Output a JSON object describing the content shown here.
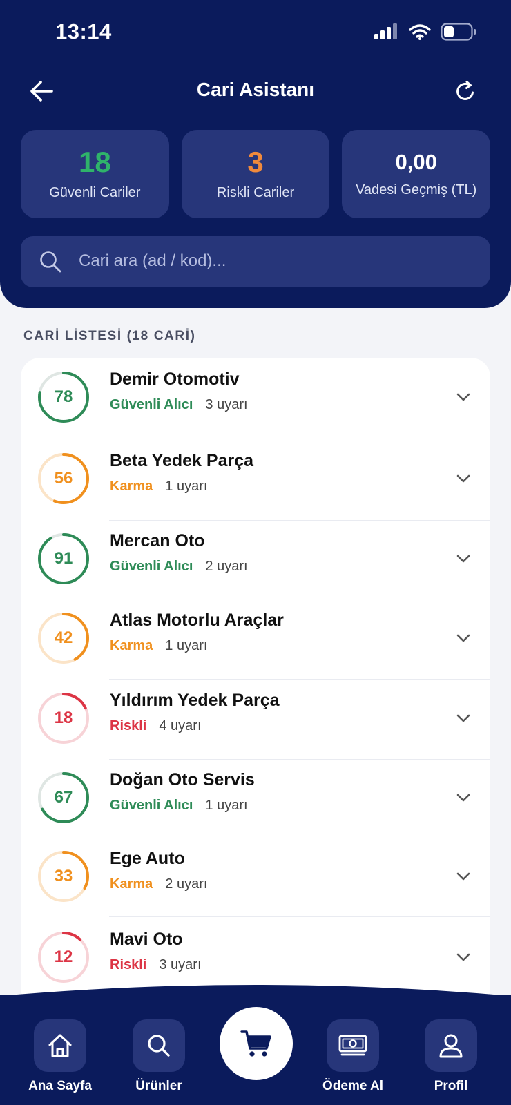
{
  "status_bar": {
    "time": "13:14"
  },
  "header": {
    "title": "Cari Asistanı"
  },
  "stats": [
    {
      "value": "18",
      "label": "Güvenli Cariler",
      "color": "#2fb36a"
    },
    {
      "value": "3",
      "label": "Riskli Cariler",
      "color": "#f08a3c"
    },
    {
      "value": "0,00",
      "label": "Vadesi Geçmiş (TL)",
      "color": "#ffffff"
    }
  ],
  "search": {
    "placeholder": "Cari ara (ad / kod)..."
  },
  "list": {
    "title": "CARİ LİSTESİ (18 CARİ)",
    "items": [
      {
        "score": "78",
        "name": "Demir Otomotiv",
        "tag": "Güvenli Alıcı",
        "warnings": "3 uyarı",
        "status": "safe"
      },
      {
        "score": "56",
        "name": "Beta Yedek Parça",
        "tag": "Karma",
        "warnings": "1 uyarı",
        "status": "mixed"
      },
      {
        "score": "91",
        "name": "Mercan Oto",
        "tag": "Güvenli Alıcı",
        "warnings": "2 uyarı",
        "status": "safe"
      },
      {
        "score": "42",
        "name": "Atlas Motorlu Araçlar",
        "tag": "Karma",
        "warnings": "1 uyarı",
        "status": "mixed"
      },
      {
        "score": "18",
        "name": "Yıldırım Yedek Parça",
        "tag": "Riskli",
        "warnings": "4 uyarı",
        "status": "risky"
      },
      {
        "score": "67",
        "name": "Doğan Oto Servis",
        "tag": "Güvenli Alıcı",
        "warnings": "1 uyarı",
        "status": "safe"
      },
      {
        "score": "33",
        "name": "Ege Auto",
        "tag": "Karma",
        "warnings": "2 uyarı",
        "status": "mixed"
      },
      {
        "score": "12",
        "name": "Mavi Oto",
        "tag": "Riskli",
        "warnings": "3 uyarı",
        "status": "risky"
      }
    ]
  },
  "status_colors": {
    "safe": "#2e8b57",
    "mixed": "#f0901e",
    "risky": "#dc3545"
  },
  "bottom_nav": {
    "home_label": "Ana Sayfa",
    "products_label": "Ürünler",
    "payment_label": "Ödeme Al",
    "profile_label": "Profil"
  },
  "icons": [
    "back-arrow-icon",
    "refresh-icon",
    "search-icon",
    "chevron-down-icon",
    "home-icon",
    "cart-icon",
    "cash-icon",
    "user-icon",
    "signal-icon",
    "wifi-icon",
    "battery-icon"
  ]
}
